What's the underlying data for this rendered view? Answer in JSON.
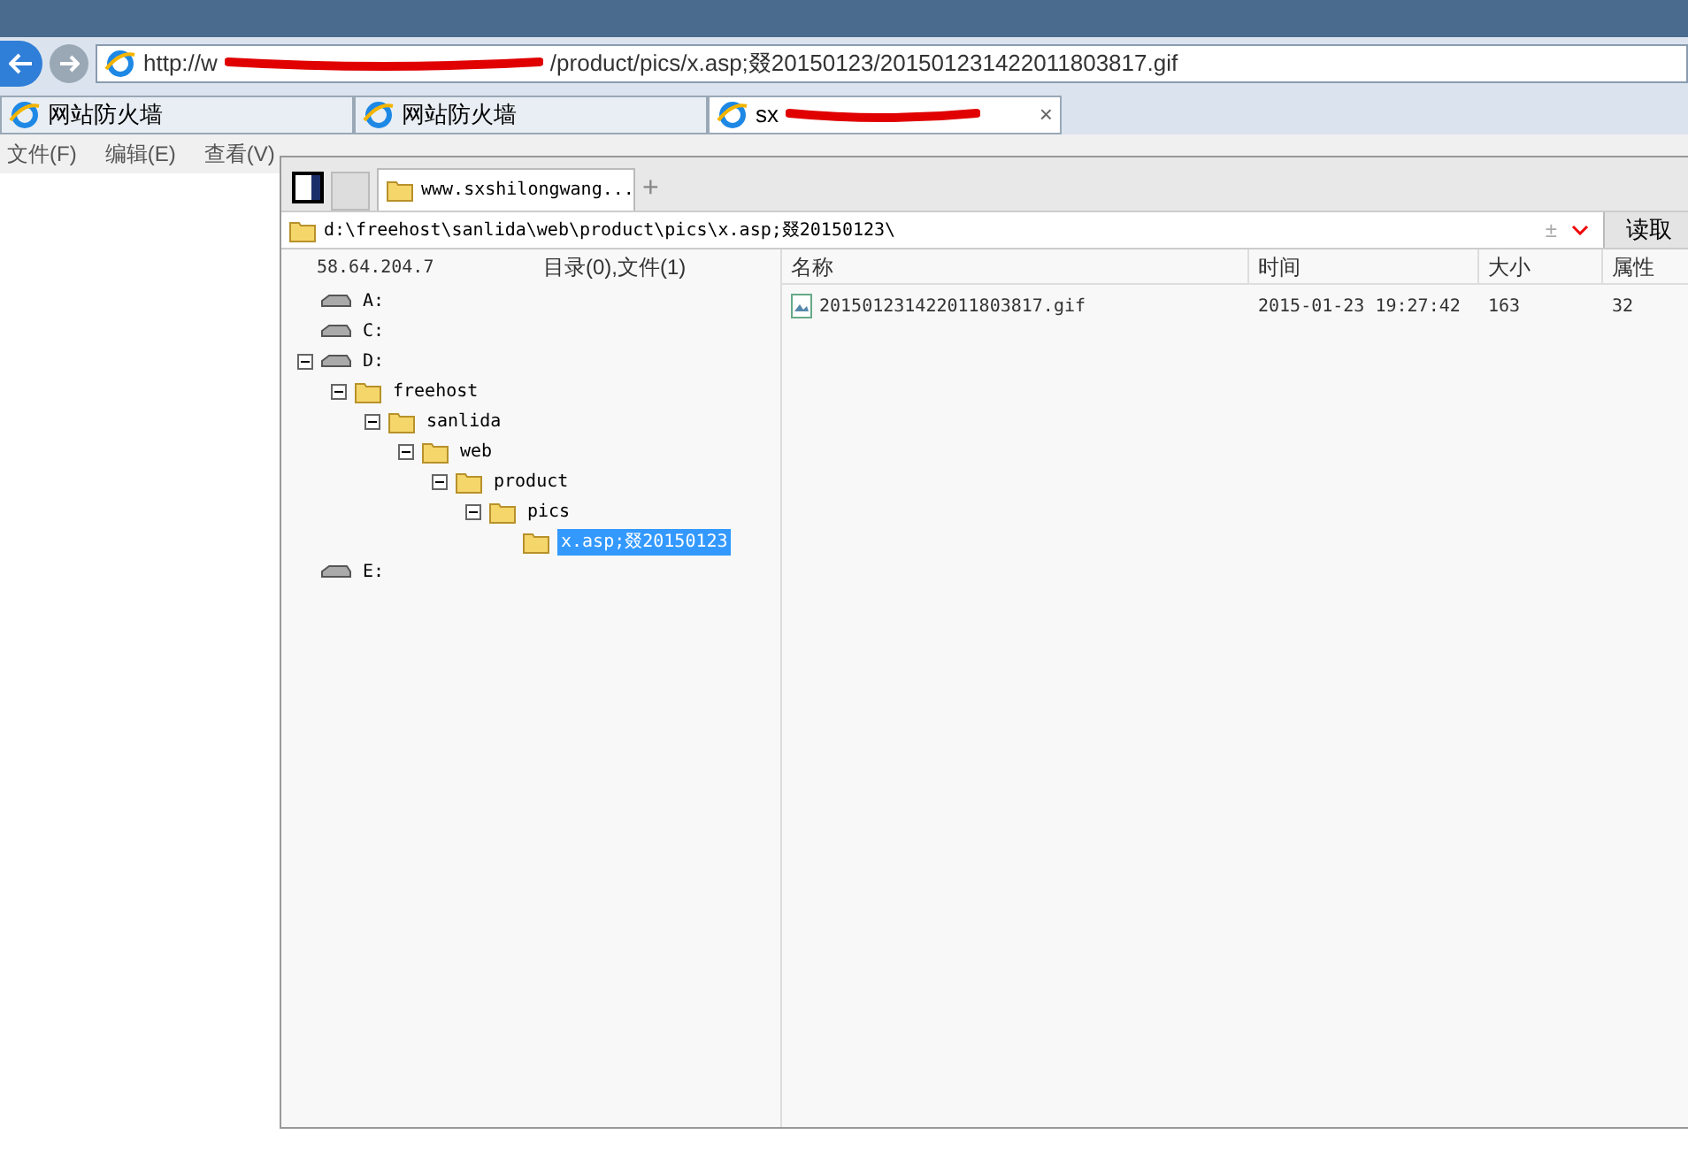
{
  "browser": {
    "url_start": "http://w",
    "url_end": "/product/pics/x.asp;叕20150123/201501231422011803817.gif",
    "tabs": [
      {
        "title": "网站防火墙",
        "selected": false,
        "redacted": false
      },
      {
        "title": "网站防火墙",
        "selected": false,
        "redacted": false
      },
      {
        "title": "sx",
        "selected": true,
        "redacted": true,
        "close": "×"
      }
    ],
    "menu": [
      "文件(F)",
      "编辑(E)",
      "查看(V)"
    ]
  },
  "manager": {
    "tab_title": "www.sxshilongwang...",
    "tab_add": "+",
    "path": "d:\\freehost\\sanlida\\web\\product\\pics\\x.asp;叕20150123\\",
    "path_marker": "±",
    "read_button": "读取",
    "host": "58.64.204.7",
    "summary": "目录(0),文件(1)",
    "columns": [
      "名称",
      "时间",
      "大小",
      "属性"
    ],
    "tree": [
      {
        "kind": "drive",
        "label": "A:",
        "selected": false
      },
      {
        "kind": "drive",
        "label": "C:",
        "selected": false
      },
      {
        "kind": "drive",
        "label": "D:",
        "expanded": true,
        "selected": false,
        "children": [
          {
            "kind": "folder",
            "label": "freehost",
            "expanded": true,
            "selected": false,
            "children": [
              {
                "kind": "folder",
                "label": "sanlida",
                "expanded": true,
                "selected": false,
                "children": [
                  {
                    "kind": "folder",
                    "label": "web",
                    "expanded": true,
                    "selected": false,
                    "children": [
                      {
                        "kind": "folder",
                        "label": "product",
                        "expanded": true,
                        "selected": false,
                        "children": [
                          {
                            "kind": "folder",
                            "label": "pics",
                            "expanded": true,
                            "selected": false,
                            "children": [
                              {
                                "kind": "folder",
                                "label": "x.asp;叕20150123",
                                "selected": true
                              }
                            ]
                          }
                        ]
                      }
                    ]
                  }
                ]
              }
            ]
          }
        ]
      },
      {
        "kind": "drive",
        "label": "E:",
        "selected": false
      }
    ],
    "files": [
      {
        "name": "201501231422011803817.gif",
        "time": "2015-01-23 19:27:42",
        "size": "163",
        "attr": "32"
      }
    ]
  }
}
